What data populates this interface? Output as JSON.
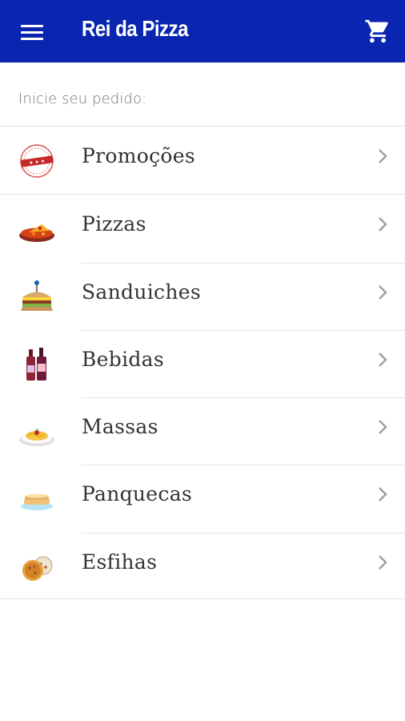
{
  "appbar": {
    "menu_icon": "menu-icon",
    "title": "Rei da Pizza",
    "cart_icon": "cart-icon",
    "background": "#0a26b0"
  },
  "main": {
    "prompt": "Inicie seu pedido:",
    "categories": [
      {
        "label": "Promoções",
        "icon": "promo-stamp-icon"
      },
      {
        "label": "Pizzas",
        "icon": "pizza-icon"
      },
      {
        "label": "Sanduiches",
        "icon": "sandwich-icon"
      },
      {
        "label": "Bebidas",
        "icon": "bottles-icon"
      },
      {
        "label": "Massas",
        "icon": "pasta-icon"
      },
      {
        "label": "Panquecas",
        "icon": "pancake-icon"
      },
      {
        "label": "Esfihas",
        "icon": "esfiha-icon"
      }
    ],
    "chevron_icon": "chevron-right-icon"
  }
}
